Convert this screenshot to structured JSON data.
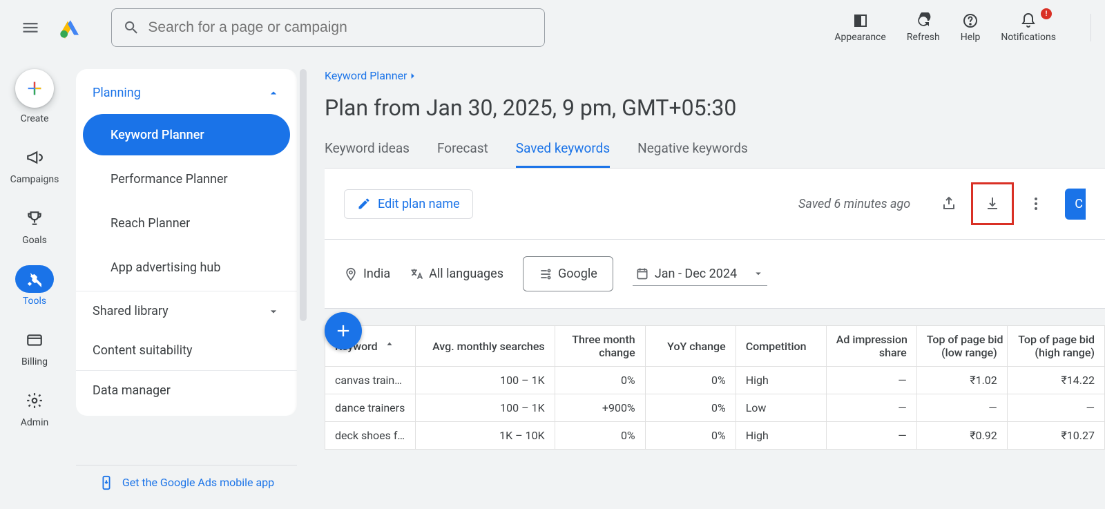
{
  "header": {
    "search_placeholder": "Search for a page or campaign",
    "actions": {
      "appearance": "Appearance",
      "refresh": "Refresh",
      "help": "Help",
      "notifications": "Notifications",
      "notif_badge": "!"
    }
  },
  "rail": {
    "create": "Create",
    "campaigns": "Campaigns",
    "goals": "Goals",
    "tools": "Tools",
    "billing": "Billing",
    "admin": "Admin"
  },
  "panel": {
    "heading": "Planning",
    "items": {
      "keyword_planner": "Keyword Planner",
      "performance_planner": "Performance Planner",
      "reach_planner": "Reach Planner",
      "app_hub": "App advertising hub"
    },
    "sections": {
      "shared_library": "Shared library",
      "content_suitability": "Content suitability",
      "data_manager": "Data manager"
    },
    "mobile_app": "Get the Google Ads mobile app"
  },
  "main": {
    "breadcrumb": "Keyword Planner",
    "title": "Plan from Jan 30, 2025, 9 pm, GMT+05:30",
    "tabs": {
      "ideas": "Keyword ideas",
      "forecast": "Forecast",
      "saved": "Saved keywords",
      "negative": "Negative keywords"
    },
    "edit_plan": "Edit plan name",
    "saved_text": "Saved 6 minutes ago",
    "create_campaign_clip": "C",
    "filters": {
      "location": "India",
      "language": "All languages",
      "network": "Google",
      "date": "Jan - Dec 2024"
    },
    "columns": {
      "keyword": "Keyword",
      "avg": "Avg. monthly searches",
      "three_month_l1": "Three month",
      "three_month_l2": "change",
      "yoy": "YoY change",
      "competition": "Competition",
      "impression_l1": "Ad impression",
      "impression_l2": "share",
      "top_low_l1": "Top of page bid",
      "top_low_l2": "(low range)",
      "top_high_l1": "Top of page bid",
      "top_high_l2": "(high range)"
    },
    "rows": [
      {
        "keyword": "canvas traine…",
        "avg": "100 – 1K",
        "three": "0%",
        "yoy": "0%",
        "comp": "High",
        "imp": "—",
        "low": "₹1.02",
        "high": "₹14.22"
      },
      {
        "keyword": "dance trainers",
        "avg": "100 – 1K",
        "three": "+900%",
        "yoy": "0%",
        "comp": "Low",
        "imp": "—",
        "low": "—",
        "high": "—"
      },
      {
        "keyword": "deck shoes f…",
        "avg": "1K – 10K",
        "three": "0%",
        "yoy": "0%",
        "comp": "High",
        "imp": "—",
        "low": "₹0.92",
        "high": "₹10.27"
      }
    ]
  }
}
